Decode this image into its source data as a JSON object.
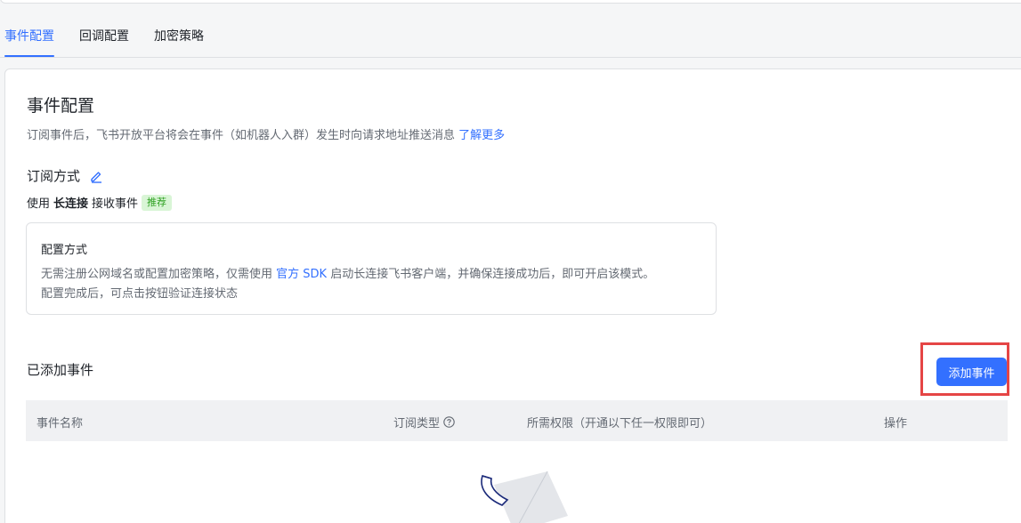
{
  "tabs": [
    {
      "label": "事件配置",
      "active": true
    },
    {
      "label": "回调配置",
      "active": false
    },
    {
      "label": "加密策略",
      "active": false
    }
  ],
  "section": {
    "title": "事件配置",
    "description": "订阅事件后，飞书开放平台将会在事件（如机器人入群）发生时向请求地址推送消息",
    "learn_more": "了解更多"
  },
  "subscription": {
    "title": "订阅方式",
    "edit_icon": "edit-icon",
    "method_prefix": "使用",
    "method_name": "长连接",
    "method_suffix": "接收事件",
    "badge": "推荐"
  },
  "config_box": {
    "title": "配置方式",
    "line1_prefix": "无需注册公网域名或配置加密策略，仅需使用",
    "line1_link": "官方 SDK",
    "line1_suffix": "启动长连接飞书客户端，并确保连接成功后，即可开启该模式。",
    "line2": "配置完成后，可点击按钮验证连接状态"
  },
  "events": {
    "title": "已添加事件",
    "add_button": "添加事件",
    "columns": [
      "事件名称",
      "订阅类型",
      "所需权限（开通以下任一权限即可）",
      "操作"
    ],
    "rows": []
  },
  "colors": {
    "accent": "#3370ff",
    "badge_bg": "#d9f5d6",
    "badge_text": "#2ea121",
    "highlight": "#e54545"
  }
}
